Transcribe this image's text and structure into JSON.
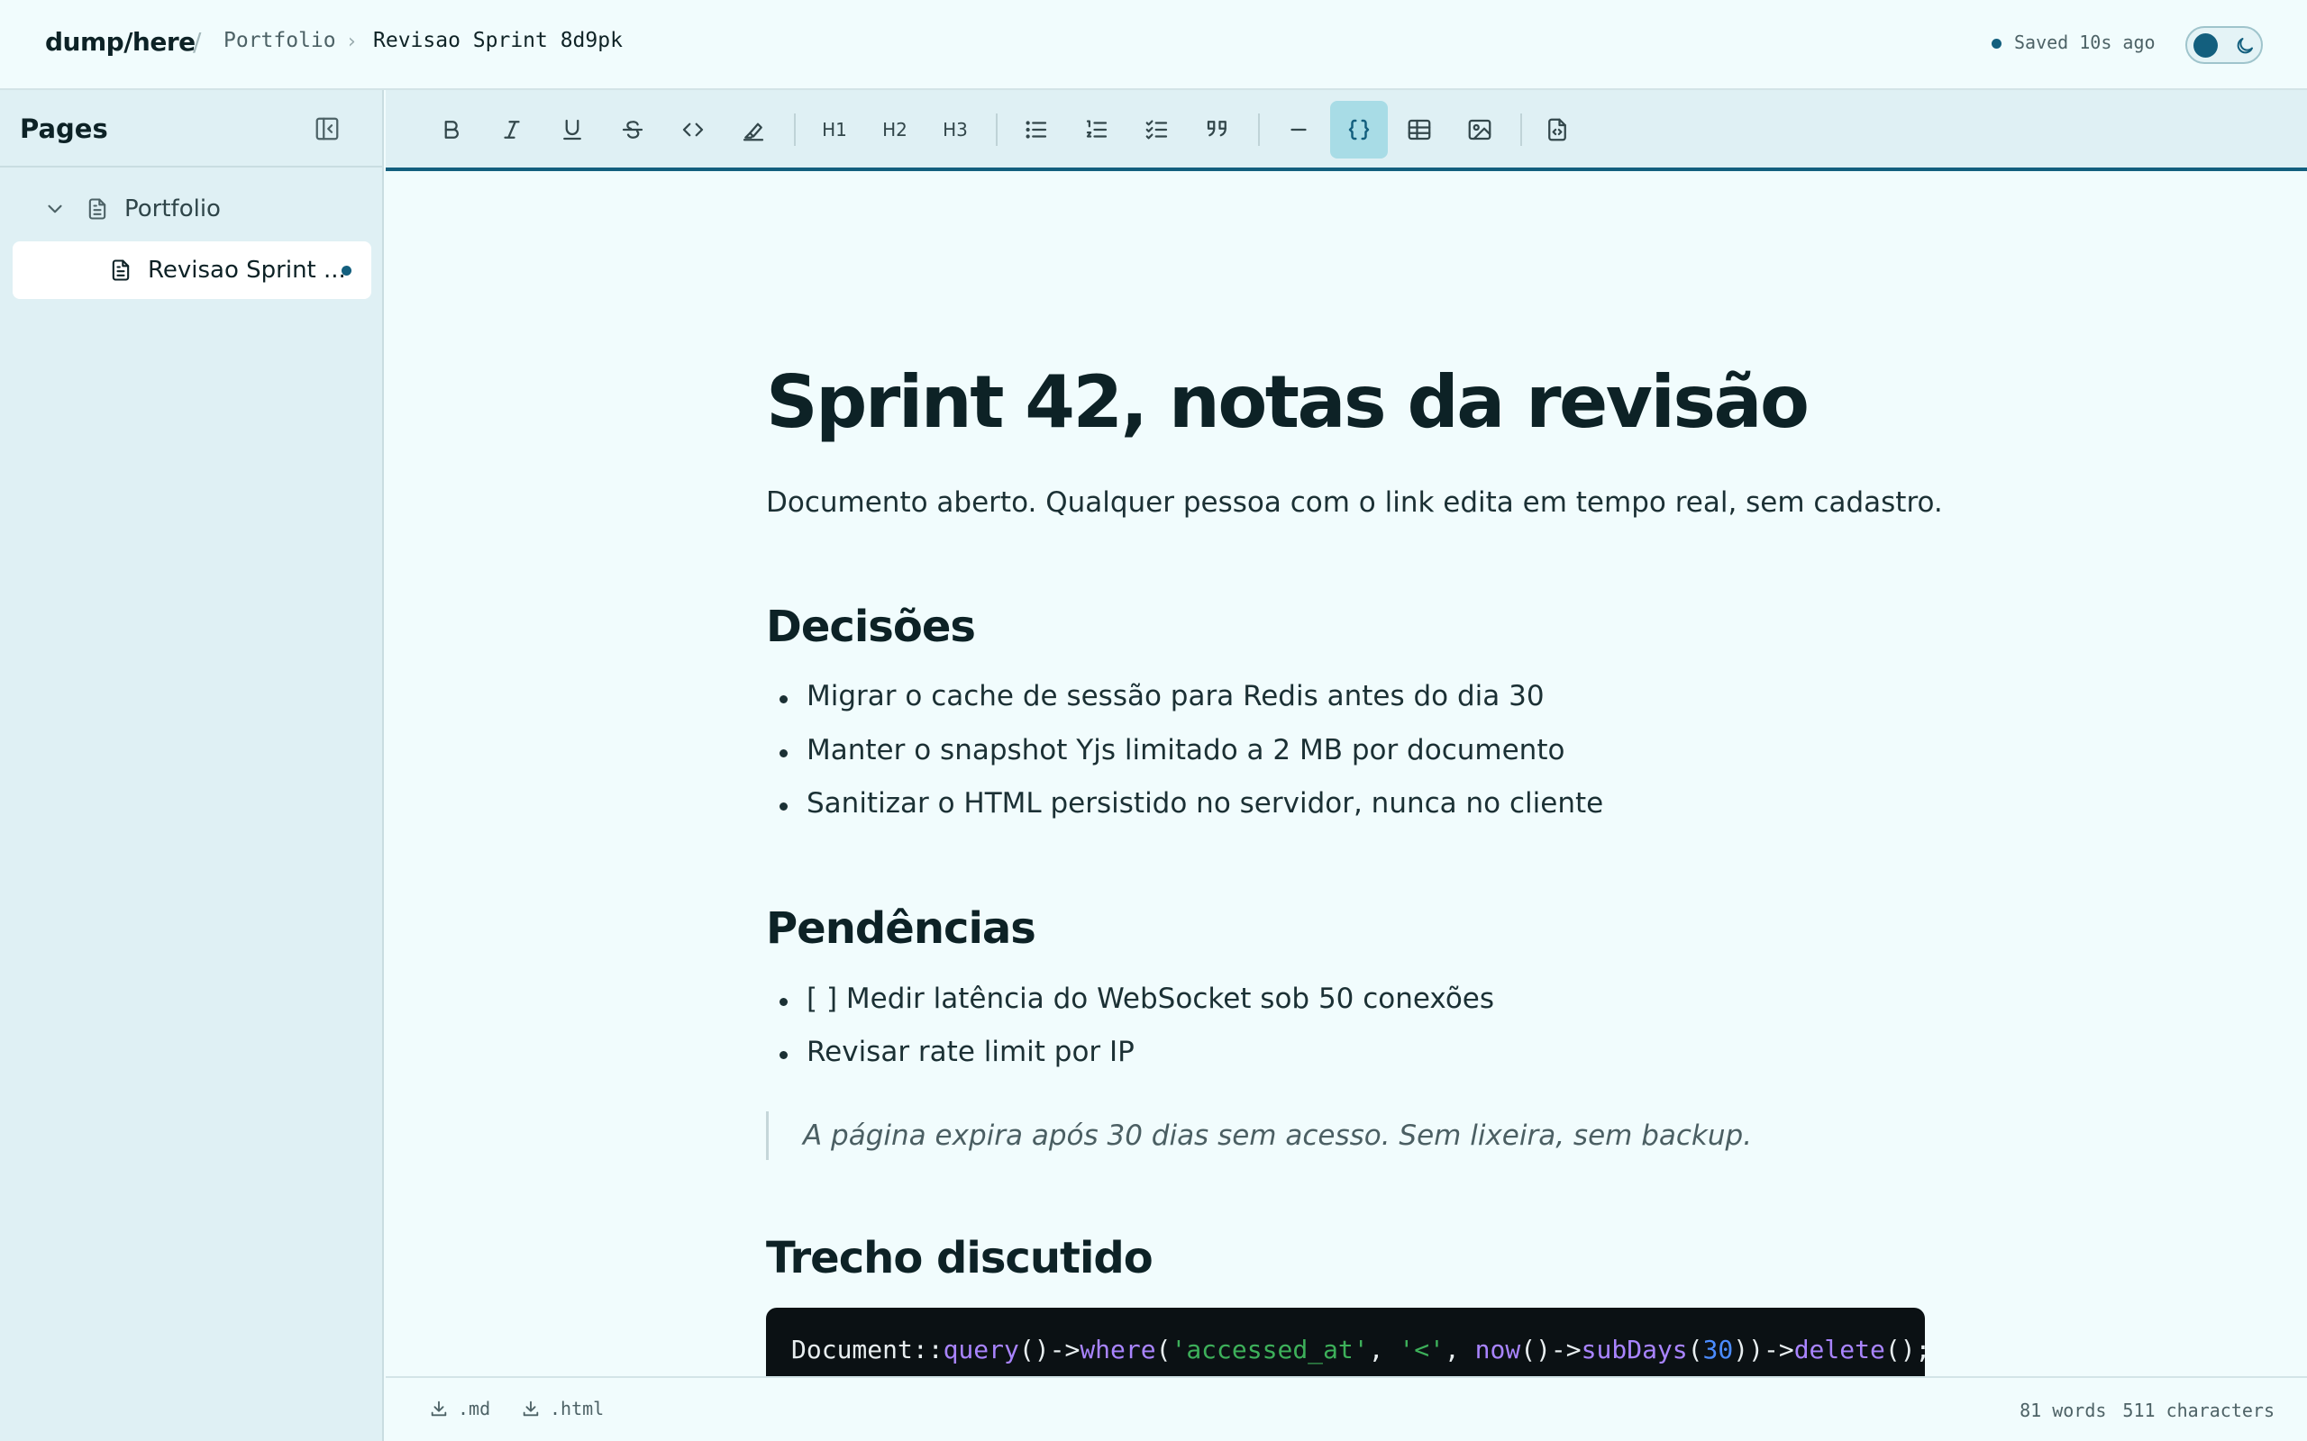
{
  "header": {
    "brand": "dump/here",
    "breadcrumb_sep": "/",
    "breadcrumb": [
      "Portfolio",
      "Revisao Sprint 8d9pk"
    ],
    "save_status": "Saved 10s ago"
  },
  "sidebar": {
    "title": "Pages",
    "tree": [
      {
        "label": "Portfolio",
        "expanded": true
      },
      {
        "label": "Revisao Sprint ...",
        "active": true
      }
    ]
  },
  "toolbar": {
    "buttons": [
      "bold",
      "italic",
      "underline",
      "strikethrough",
      "inline-code",
      "highlight",
      "heading-1",
      "heading-2",
      "heading-3",
      "bullet-list",
      "ordered-list",
      "task-list",
      "blockquote",
      "horizontal-rule",
      "code-block",
      "table",
      "image",
      "html-source"
    ],
    "active": "code-block",
    "h1": "H1",
    "h2": "H2",
    "h3": "H3"
  },
  "document": {
    "title": "Sprint 42, notas da revisão",
    "lead": "Documento aberto. Qualquer pessoa com o link edita em tempo real, sem cadastro.",
    "sections": [
      {
        "heading": "Decisões",
        "items": [
          "Migrar o cache de sessão para Redis antes do dia 30",
          "Manter o snapshot Yjs limitado a 2 MB por documento",
          "Sanitizar o HTML persistido no servidor, nunca no cliente"
        ]
      },
      {
        "heading": "Pendências",
        "items": [
          "[ ] Medir latência do WebSocket sob 50 conexões",
          "Revisar rate limit por IP"
        ]
      }
    ],
    "quote": "A página expira após 30 dias sem acesso. Sem lixeira, sem backup.",
    "code_heading": "Trecho discutido",
    "code": {
      "p1": "Document::",
      "f1": "query",
      "p2": "()->",
      "f2": "where",
      "p3": "(",
      "s1": "'accessed_at'",
      "p4": ", ",
      "s2": "'<'",
      "p5": ", ",
      "f3": "now",
      "p6": "()->",
      "f4": "subDays",
      "p7": "(",
      "n1": "30",
      "p8": "))->",
      "f5": "delete",
      "p9": "();"
    }
  },
  "footer": {
    "export_md": ".md",
    "export_html": ".html",
    "words": "81 words",
    "characters": "511 characters"
  },
  "colors": {
    "accent": "#135f7e",
    "background": "#f1fcfd",
    "sidebar": "#dff0f4",
    "code_bg": "#0b1114"
  }
}
